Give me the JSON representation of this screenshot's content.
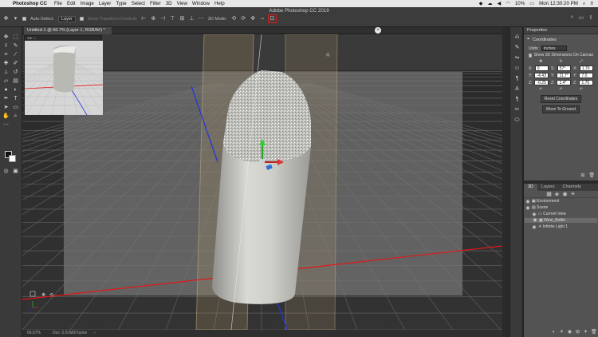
{
  "menubar": {
    "app_name": "Photoshop CC",
    "items": [
      "File",
      "Edit",
      "Image",
      "Layer",
      "Type",
      "Select",
      "Filter",
      "3D",
      "View",
      "Window",
      "Help"
    ],
    "battery": "10%",
    "clock": "Mon 12:30:20 PM"
  },
  "app_title": "Adobe Photoshop CC 2019",
  "options": {
    "auto_select_label": "Auto-Select:",
    "auto_select_value": "Layer",
    "transform_controls": "Show Transform Controls",
    "mode_label": "3D Mode:"
  },
  "document": {
    "tab_title": "Untitled-1 @ 66.7% (Layer 1, RGB/8#) *"
  },
  "status": {
    "zoom": "66.67%",
    "doc": "Doc: 0.61M/0 bytes"
  },
  "properties": {
    "tab": "Properties",
    "title": "Coordinates",
    "units_label": "Units:",
    "units_value": "Inches",
    "show3d": "Show 3D Dimensions On Canvas",
    "rows": [
      [
        {
          "l": "X:",
          "v": "0"
        },
        {
          "l": "S:",
          "v": "57°"
        },
        {
          "l": "X:",
          "v": "1.70"
        }
      ],
      [
        {
          "l": "Y:",
          "v": "-4.43"
        },
        {
          "l": "Y:",
          "v": "11.7°"
        },
        {
          "l": "Y:",
          "v": "7.0"
        }
      ],
      [
        {
          "l": "Z:",
          "v": "-0.25"
        },
        {
          "l": "Z:",
          "v": "1.4°"
        },
        {
          "l": "Z:",
          "v": "1.70"
        }
      ]
    ],
    "reset_btn": "Reset Coordinates",
    "ground_btn": "Move To Ground"
  },
  "panel3d": {
    "tabs": [
      "3D",
      "Layers",
      "Channels"
    ],
    "items": [
      {
        "label": "Environment",
        "indent": 0,
        "selected": false
      },
      {
        "label": "Scene",
        "indent": 0,
        "selected": false
      },
      {
        "label": "Current View",
        "indent": 1,
        "selected": false
      },
      {
        "label": "Wine_Bottle",
        "indent": 1,
        "selected": true
      },
      {
        "label": "Infinite Light 1",
        "indent": 1,
        "selected": false
      }
    ]
  }
}
